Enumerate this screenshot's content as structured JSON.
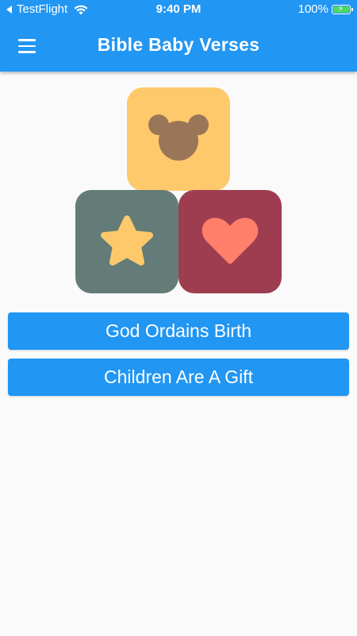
{
  "status_bar": {
    "carrier": "TestFlight",
    "time": "9:40 PM",
    "battery_percent": "100%"
  },
  "app_bar": {
    "title": "Bible Baby Verses",
    "menu_icon": "hamburger-menu-icon"
  },
  "illustration": {
    "blocks": [
      {
        "name": "bear",
        "icon": "bear-icon",
        "color": "#fec96b",
        "icon_color": "#9a7658"
      },
      {
        "name": "star",
        "icon": "star-icon",
        "color": "#637c77",
        "icon_color": "#fec96b"
      },
      {
        "name": "heart",
        "icon": "heart-icon",
        "color": "#9e3d50",
        "icon_color": "#ff7f6a"
      }
    ]
  },
  "buttons": [
    {
      "label": "God Ordains Birth"
    },
    {
      "label": "Children Are A Gift"
    }
  ],
  "colors": {
    "primary": "#2196f3",
    "background": "#fafafa"
  }
}
